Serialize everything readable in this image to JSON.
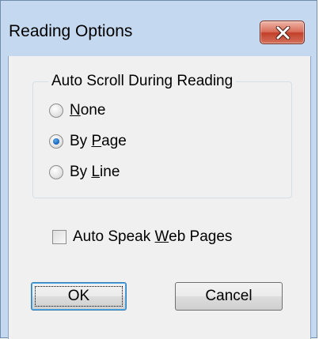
{
  "dialog": {
    "title": "Reading Options",
    "close_icon": "close-icon"
  },
  "auto_scroll": {
    "label": "Auto Scroll During Reading",
    "options": [
      {
        "pre": "",
        "key": "N",
        "post": "one",
        "selected": false
      },
      {
        "pre": "By ",
        "key": "P",
        "post": "age",
        "selected": true
      },
      {
        "pre": "By ",
        "key": "L",
        "post": "ine",
        "selected": false
      }
    ]
  },
  "auto_speak": {
    "pre": "Auto Speak ",
    "key": "W",
    "post": "eb Pages",
    "checked": false
  },
  "buttons": {
    "ok": "OK",
    "cancel": "Cancel"
  },
  "colors": {
    "frame": "#c4d9f0",
    "client": "#f0f0f0",
    "close_button": "#c13f2a",
    "selected_radio": "#1c6bc2"
  }
}
